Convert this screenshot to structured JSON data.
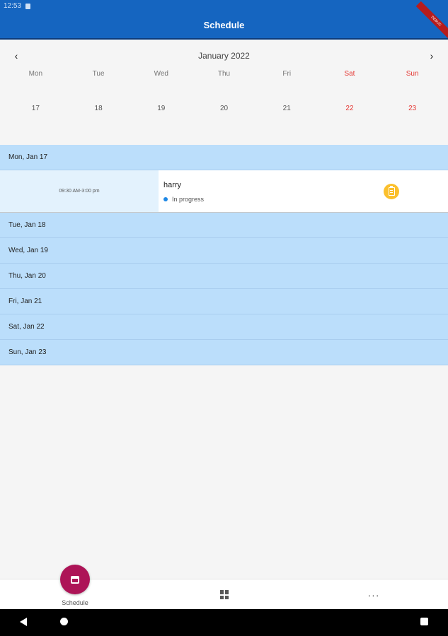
{
  "status_bar": {
    "time": "12:53"
  },
  "app_bar": {
    "title": "Schedule",
    "debug_banner": "DEBUG"
  },
  "calendar": {
    "month_label": "January 2022",
    "prev_icon": "chevron-left-icon",
    "next_icon": "chevron-right-icon",
    "weekdays": [
      "Mon",
      "Tue",
      "Wed",
      "Thu",
      "Fri",
      "Sat",
      "Sun"
    ],
    "dates": [
      "17",
      "18",
      "19",
      "20",
      "21",
      "22",
      "23"
    ],
    "weekend_color": "#e53935"
  },
  "agenda": {
    "days": [
      {
        "header": "Mon, Jan 17"
      },
      {
        "header": "Tue, Jan 18"
      },
      {
        "header": "Wed, Jan 19"
      },
      {
        "header": "Thu, Jan 20"
      },
      {
        "header": "Fri, Jan 21"
      },
      {
        "header": "Sat, Jan 22"
      },
      {
        "header": "Sun, Jan 23"
      }
    ],
    "event": {
      "time": "09:30 AM-3:00 pm",
      "name": "harry",
      "status": "In progress",
      "status_color": "#1e88e5",
      "icon": "clipboard-icon",
      "icon_color": "#fbc02d"
    }
  },
  "bottom_nav": {
    "schedule_label": "Schedule",
    "schedule_icon": "calendar-icon",
    "grid_icon": "grid-icon",
    "more_icon": "more-horizontal-icon",
    "more_glyph": "···",
    "accent": "#ad1457"
  },
  "colors": {
    "app_bar": "#1565c0",
    "day_header_bg": "#bbdefb",
    "event_time_bg": "#e3f2fd"
  }
}
